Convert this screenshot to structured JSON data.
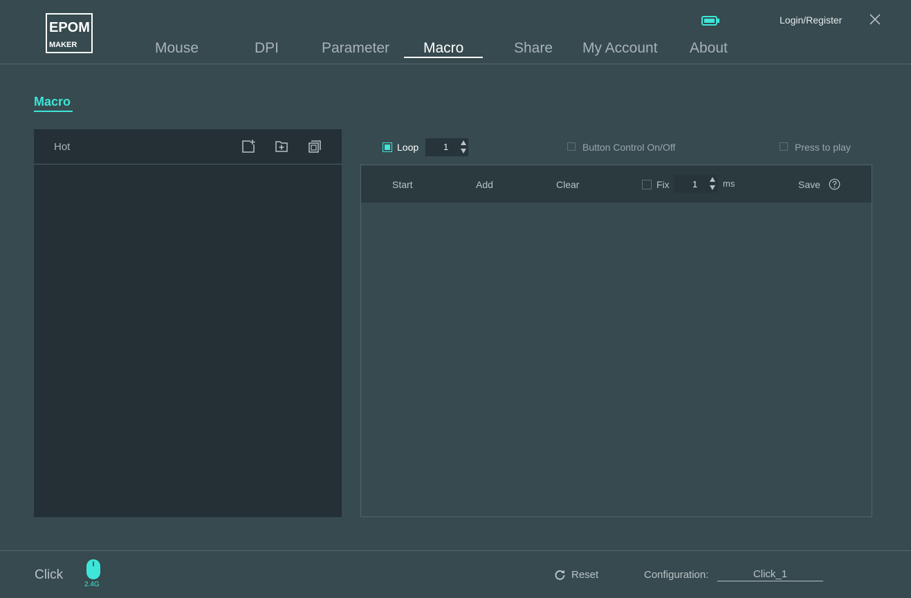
{
  "logo": {
    "line1": "EPOM",
    "line2": "MAKER",
    "glyph": "M"
  },
  "nav": {
    "tabs": [
      {
        "label": "Mouse"
      },
      {
        "label": "DPI"
      },
      {
        "label": "Parameter"
      },
      {
        "label": "Macro"
      },
      {
        "label": "Share"
      },
      {
        "label": "My Account"
      },
      {
        "label": "About"
      }
    ],
    "active": "Macro"
  },
  "header": {
    "login_label": "Login/Register",
    "battery_icon": "battery-icon",
    "close_icon": "close-icon"
  },
  "section": {
    "title": "Macro"
  },
  "left_panel": {
    "header_label": "Hot",
    "icons": [
      "new-macro-icon",
      "add-folder-icon",
      "copy-icon"
    ]
  },
  "controls": {
    "loop_label": "Loop",
    "loop_checked": true,
    "loop_count": "1",
    "button_control_label": "Button Control On/Off",
    "button_control_checked": false,
    "press_to_play_label": "Press to play",
    "press_to_play_checked": false
  },
  "toolbar": {
    "start_label": "Start",
    "add_label": "Add",
    "clear_label": "Clear",
    "fix_label": "Fix",
    "fix_checked": false,
    "fix_value": "1",
    "ms_label": "ms",
    "save_label": "Save",
    "help_icon": "help-icon"
  },
  "footer": {
    "device_name": "Click",
    "connection": "2.4G",
    "reset_label": "Reset",
    "config_label": "Configuration:",
    "config_value": "Click_1"
  },
  "colors": {
    "background": "#364a4f",
    "panel_dark": "#243035",
    "accent": "#3ee6d8",
    "text": "#c9d1d3"
  }
}
